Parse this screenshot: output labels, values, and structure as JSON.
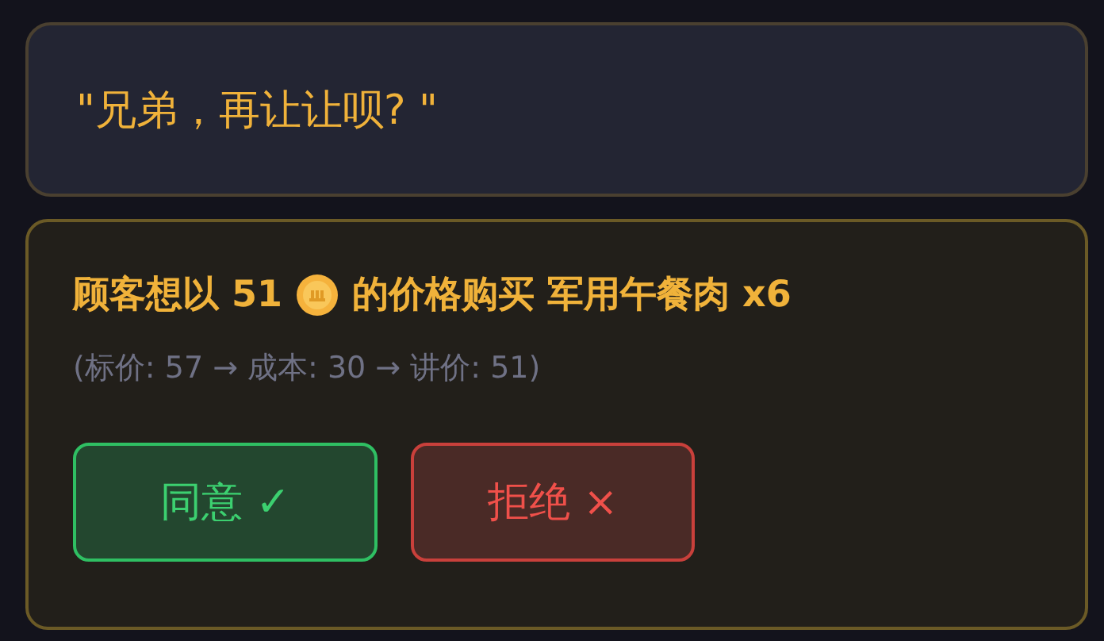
{
  "quote": "\"兄弟，再让让呗? \"",
  "offer": {
    "before": "顾客想以 51",
    "after": "的价格购买 军用午餐肉 x6"
  },
  "detail": "(标价: 57 → 成本: 30 → 讲价: 51)",
  "buttons": [
    {
      "kind": "accept",
      "label": "同意 ✓"
    },
    {
      "kind": "reject",
      "label": "拒绝 ×"
    }
  ]
}
